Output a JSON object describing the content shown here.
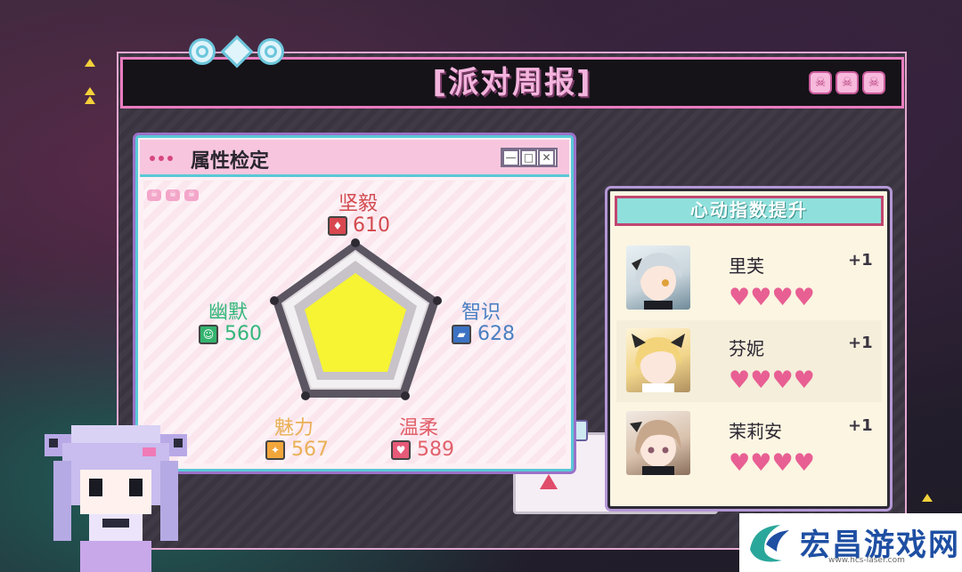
{
  "title": "[派对周报]",
  "stats_window": {
    "title": "属性检定",
    "window_buttons": [
      "—",
      "□",
      "✕"
    ],
    "attributes": [
      {
        "name": "坚毅",
        "value": "610",
        "color": "#d24a4f",
        "badge_color": "#d9474f"
      },
      {
        "name": "智识",
        "value": "628",
        "color": "#4a7fc1",
        "badge_color": "#3c72c4"
      },
      {
        "name": "温柔",
        "value": "589",
        "color": "#e1616b",
        "badge_color": "#e75a78"
      },
      {
        "name": "魅力",
        "value": "567",
        "color": "#e9b055",
        "badge_color": "#f2a63a"
      },
      {
        "name": "幽默",
        "value": "560",
        "color": "#33b67a",
        "badge_color": "#34b36f"
      }
    ],
    "radar_fill_color": "#f6f433"
  },
  "affection_window": {
    "title": "心动指数提升",
    "characters": [
      {
        "name": "里芙",
        "bonus": "+1",
        "hearts": 4
      },
      {
        "name": "芬妮",
        "bonus": "+1",
        "hearts": 4
      },
      {
        "name": "茉莉安",
        "bonus": "+1",
        "hearts": 4
      }
    ]
  },
  "watermark": {
    "text": "宏昌游戏网",
    "url": "www.hcs-laser.com"
  }
}
